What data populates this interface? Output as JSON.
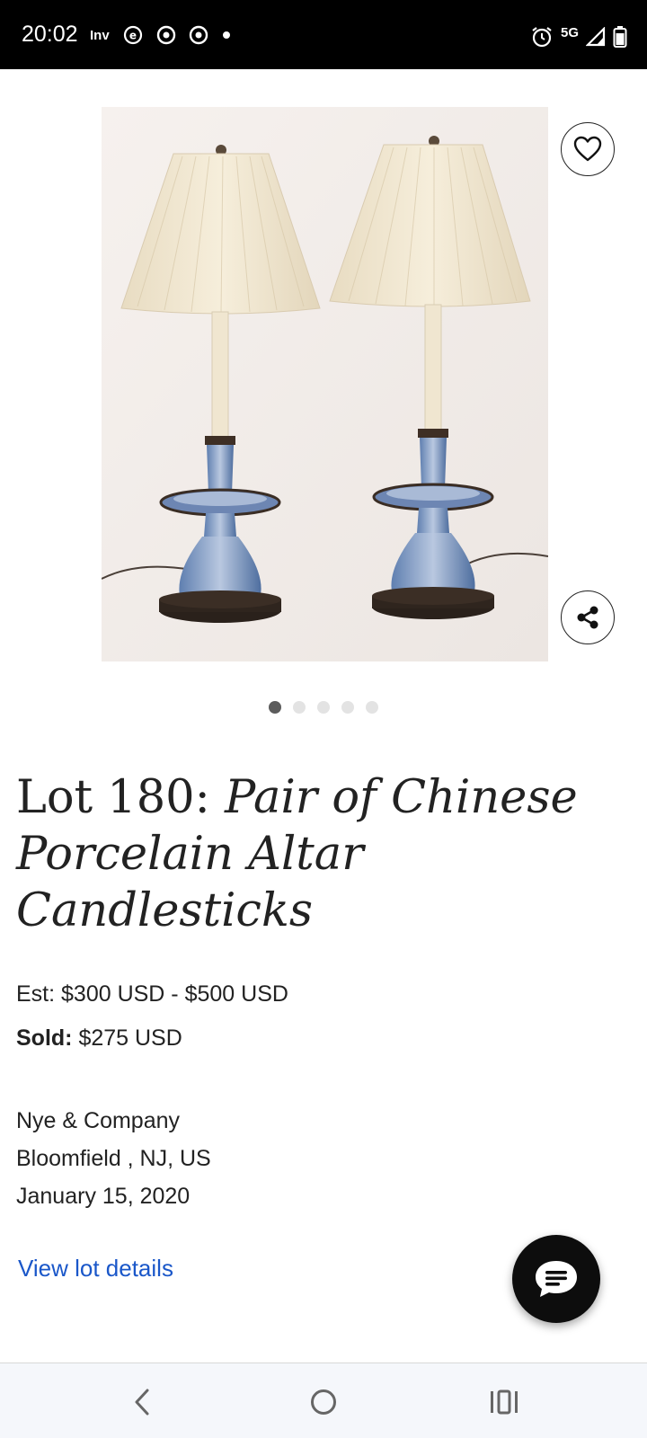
{
  "status_bar": {
    "time": "20:02",
    "left_icons": [
      "inv-app-icon",
      "e-app-icon",
      "chrome-icon",
      "chrome-icon",
      "dot-icon"
    ],
    "left_icon_text": "Inv",
    "network": "5G",
    "right_icons": [
      "alarm-icon",
      "signal-icon",
      "battery-icon"
    ]
  },
  "gallery": {
    "image_count": 5,
    "active_index": 0
  },
  "lot": {
    "number_label": "Lot 180: ",
    "name": "Pair of Chinese Porcelain Altar Candlesticks",
    "estimate": "Est: $300 USD - $500 USD",
    "sold_label": "Sold:",
    "sold_value": " $275 USD"
  },
  "auction_house": {
    "name": "Nye & Company",
    "location": "Bloomfield , NJ, US",
    "date": "January 15, 2020"
  },
  "actions": {
    "view_details": "View lot details",
    "favorite_icon": "heart-icon",
    "share_icon": "share-icon",
    "chat_icon": "chat-icon"
  },
  "nav": {
    "icons": [
      "back-icon",
      "home-icon",
      "recents-icon"
    ]
  },
  "colors": {
    "link": "#1a57c9",
    "status_bg": "#000000",
    "chat_bg": "#0d0d0d",
    "dot_active": "#5c5c5c",
    "dot_inactive": "#e3e3e3"
  }
}
